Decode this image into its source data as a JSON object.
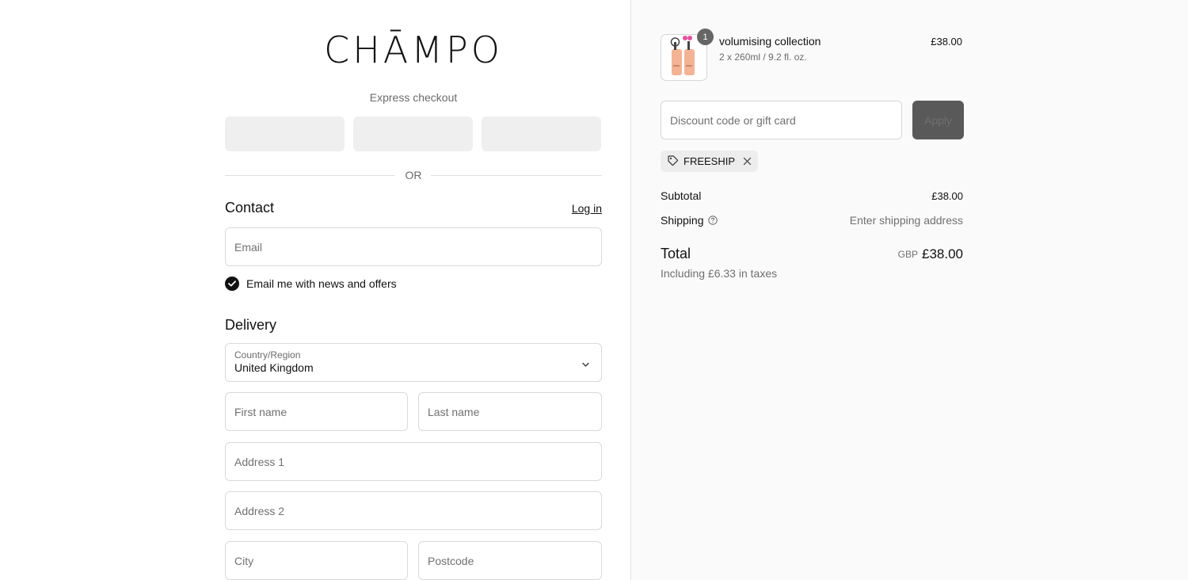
{
  "brand": {
    "logo_text": "CHĀMPO"
  },
  "express": {
    "title": "Express checkout",
    "divider": "OR"
  },
  "contact": {
    "heading": "Contact",
    "login_link": "Log in",
    "email_placeholder": "Email",
    "marketing_checkbox_label": "Email me with news and offers",
    "marketing_checked": true
  },
  "delivery": {
    "heading": "Delivery",
    "country_label": "Country/Region",
    "country_value": "United Kingdom",
    "first_name_placeholder": "First name",
    "last_name_placeholder": "Last name",
    "address1_placeholder": "Address 1",
    "address2_placeholder": "Address 2",
    "city_placeholder": "City",
    "postcode_placeholder": "Postcode"
  },
  "cart": {
    "items": [
      {
        "name": "volumising collection",
        "variant": "2 x 260ml / 9.2 fl. oz.",
        "price": "£38.00",
        "quantity": "1"
      }
    ],
    "discount_placeholder": "Discount code or gift card",
    "apply_label": "Apply",
    "applied_code": "FREESHIP",
    "subtotal_label": "Subtotal",
    "subtotal_value": "£38.00",
    "shipping_label": "Shipping",
    "shipping_value": "Enter shipping address",
    "total_label": "Total",
    "total_currency": "GBP",
    "total_value": "£38.00",
    "tax_note": "Including £6.33 in taxes"
  },
  "colors": {
    "accent_dark": "#111111",
    "panel_bg": "#fafafa",
    "apply_button": "#595959"
  }
}
